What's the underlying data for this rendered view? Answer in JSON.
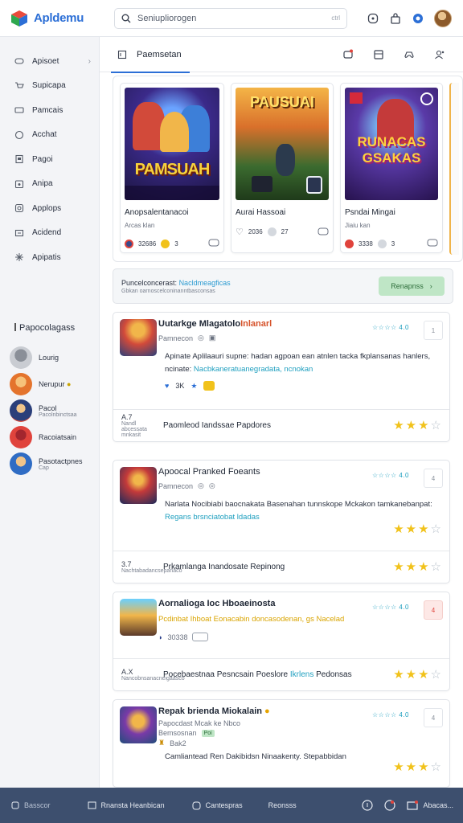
{
  "app": {
    "name": "Apldemu"
  },
  "search": {
    "placeholder": "Seniupliorogen",
    "shortcut": "ctrl"
  },
  "topbar": {
    "icons": [
      "chat-icon",
      "bag-icon",
      "notification-icon",
      "avatar"
    ]
  },
  "sidebar": {
    "items": [
      {
        "label": "Apisoet",
        "icon": "gamepad-icon"
      },
      {
        "label": "Supicapa",
        "icon": "cart-icon"
      },
      {
        "label": "Pamcais",
        "icon": "ticket-icon"
      },
      {
        "label": "Acchat",
        "icon": "chat-icon"
      },
      {
        "label": "Pagoi",
        "icon": "page-icon"
      },
      {
        "label": "Anipa",
        "icon": "calendar-icon"
      },
      {
        "label": "Applops",
        "icon": "app-icon"
      },
      {
        "label": "Acidend",
        "icon": "box-icon"
      },
      {
        "label": "Apipatis",
        "icon": "sparkle-icon"
      }
    ],
    "section": "Papocolagass",
    "people": [
      {
        "name": "Lourig",
        "sub": ""
      },
      {
        "name": "Nerupur",
        "sub": ""
      },
      {
        "name": "Pacol",
        "sub": "Pacolnbinctsaa"
      },
      {
        "name": "Racoiatsain",
        "sub": ""
      },
      {
        "name": "Pasotactpnes",
        "sub": "Cap"
      }
    ]
  },
  "tabs": {
    "active": "Paemsetan"
  },
  "featured": [
    {
      "art_title": "PAMSUAH",
      "title": "Anopsalentanacoi",
      "sub": "Arcas klan",
      "meta": "32686",
      "meta2": "3"
    },
    {
      "art_title": "PAUSUAI",
      "title": "Aurai Hassoai",
      "sub": "",
      "meta": "2036",
      "meta2": "27"
    },
    {
      "art_title": "RUNACAS GSAKAS",
      "title": "Psndai Mingai",
      "sub": "Jiaiu kan",
      "meta": "3338",
      "meta2": "3"
    }
  ],
  "promo": {
    "lead": "Puncelconcerast:",
    "link": "Nacldmeagficas",
    "sub": "Gbkan oarnoscelconinanntbasconsas",
    "button": "Renapnss"
  },
  "reviews": [
    {
      "title": "Uutarkge Mlagatolo",
      "title_accent": "Inlanarl",
      "score": "☆☆☆☆ 4.0",
      "box": "1",
      "author": "Pamnecon",
      "body": "Apinate Aplilaauri supne: hadan agpoan ean atnlen tacka fkplansanas hanlers, ncinate:",
      "body_link": "Nacbkaneratuanegradata, ncnokan",
      "react_count": "3K",
      "foot_num": "A.7",
      "foot_small": "Nandl abcessata mnkasit",
      "foot_text": "Paomleod Iandssae Papdores",
      "stars": 3
    },
    {
      "title": "Apoocal Pranked Foeants",
      "title_accent": "",
      "score": "☆☆☆☆ 4.0",
      "box": "4",
      "author": "Pamnecon",
      "body": "Narlata Nocibiabi baocnakata Basenahan tunnskope Mckakon tamkanebanpat:",
      "body_link": "Regans brsnciatobat ldadas",
      "react_count": "",
      "foot_num": "3.7",
      "foot_small": "Nachtabadancsepanaco",
      "foot_text": "Prkamlanga Inandosate Repinong",
      "stars": 3
    },
    {
      "title": "Aornalioga Ioc Hboaeinosta",
      "title_accent": "",
      "score": "☆☆☆☆ 4.0",
      "box": "4",
      "author": "",
      "body_yellow": "Pcdinbat Ihboat Eonacabin doncasodenan, gs Nacelad",
      "body": "",
      "body_link": "",
      "react_count": "30338",
      "foot_num": "A.X",
      "foot_small": "Nancobnsanacneigaasco",
      "foot_text": "Pocebaestnaa Pesncsain Poeslore",
      "foot_link": "Ikrlens",
      "foot_tail": "Pedonsas",
      "stars": 3
    },
    {
      "title": "Repak brienda Miokalain",
      "title_accent": "",
      "score": "☆☆☆☆ 4.0",
      "box": "4",
      "author": "Papocdast Mcak ke Nbco",
      "author2": "Bemsosnan",
      "badge": "Poi",
      "react_count": "Bak2",
      "body": "Camliantead Ren Dakibidsn Ninaakenty. Stepabbidan",
      "stars": 3
    }
  ],
  "bottombar": {
    "left": "Basscor",
    "items": [
      "Rnansta Heanbican",
      "Cantespras",
      "Reonsss"
    ],
    "right": "Abacas..."
  },
  "colors": {
    "accent": "#2c6fd6",
    "link": "#1e9fbf",
    "star": "#f1c21b",
    "bottom": "#3d4f6e",
    "promo_button": "#bfe6c6"
  }
}
